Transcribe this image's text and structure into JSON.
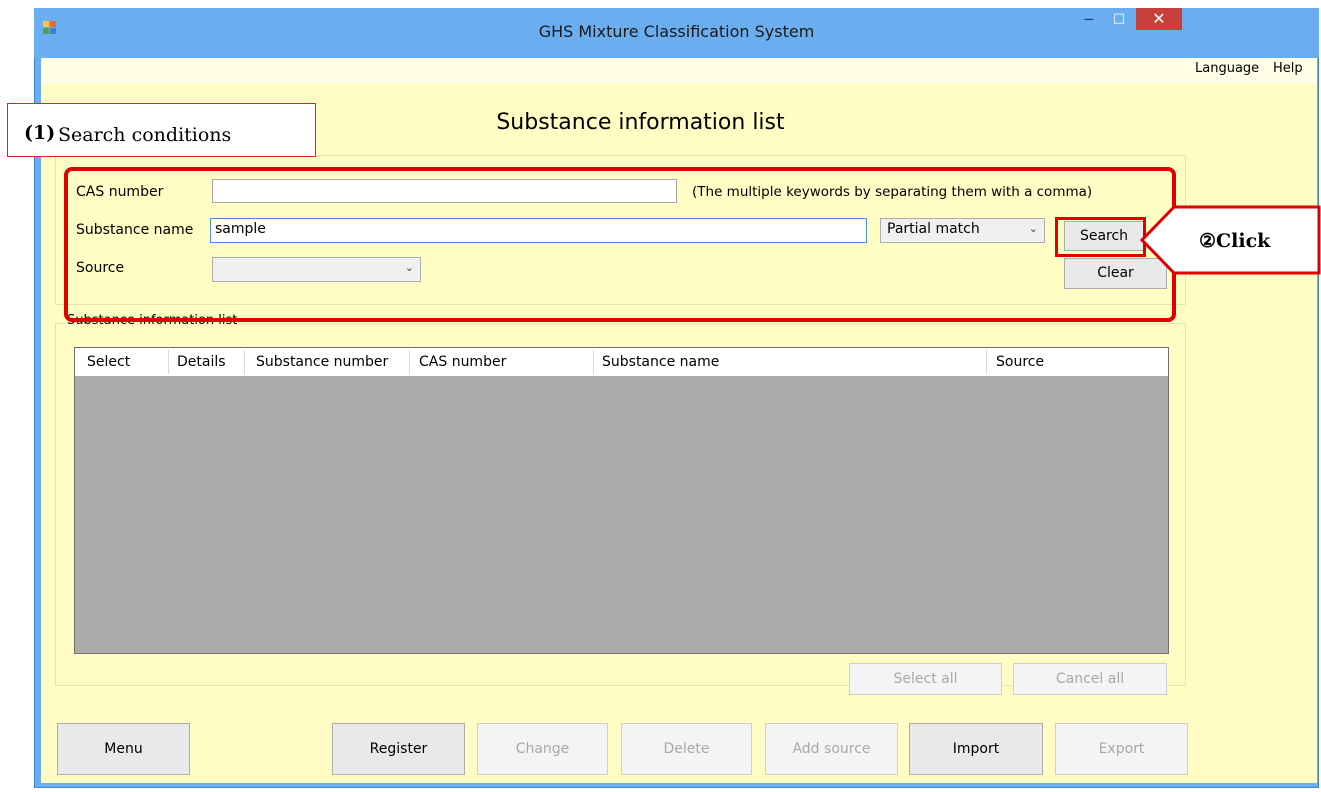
{
  "window": {
    "title": "GHS Mixture Classification System",
    "min_glyph": "‒",
    "max_glyph": "□",
    "close_glyph": "✕"
  },
  "menu": {
    "language": "Language",
    "help": "Help"
  },
  "page_title": "Substance information list",
  "annotations": {
    "callout1_number": "(1)",
    "callout1_text": "Search conditions",
    "callout2_text": "②Click",
    "highlight_color": "#e00000"
  },
  "search": {
    "cas_label": "CAS number",
    "cas_value": "",
    "cas_hint": "(The multiple keywords by separating them with a comma)",
    "name_label": "Substance name",
    "name_value": "sample",
    "match_mode": "Partial match",
    "source_label": "Source",
    "source_value": "",
    "search_button": "Search",
    "clear_button": "Clear"
  },
  "list": {
    "group_label": "Substance information list",
    "columns": [
      "Select",
      "Details",
      "Substance number",
      "CAS number",
      "Substance name",
      "Source"
    ],
    "select_all": "Select all",
    "cancel_all": "Cancel all"
  },
  "footer": {
    "menu": "Menu",
    "register": "Register",
    "change": "Change",
    "delete": "Delete",
    "add_source": "Add source",
    "import": "Import",
    "export": "Export"
  },
  "colors": {
    "titlebar": "#6aaef0",
    "client_bg": "#fffdc4",
    "grid_bg": "#ababab",
    "close_button": "#c7413a"
  }
}
